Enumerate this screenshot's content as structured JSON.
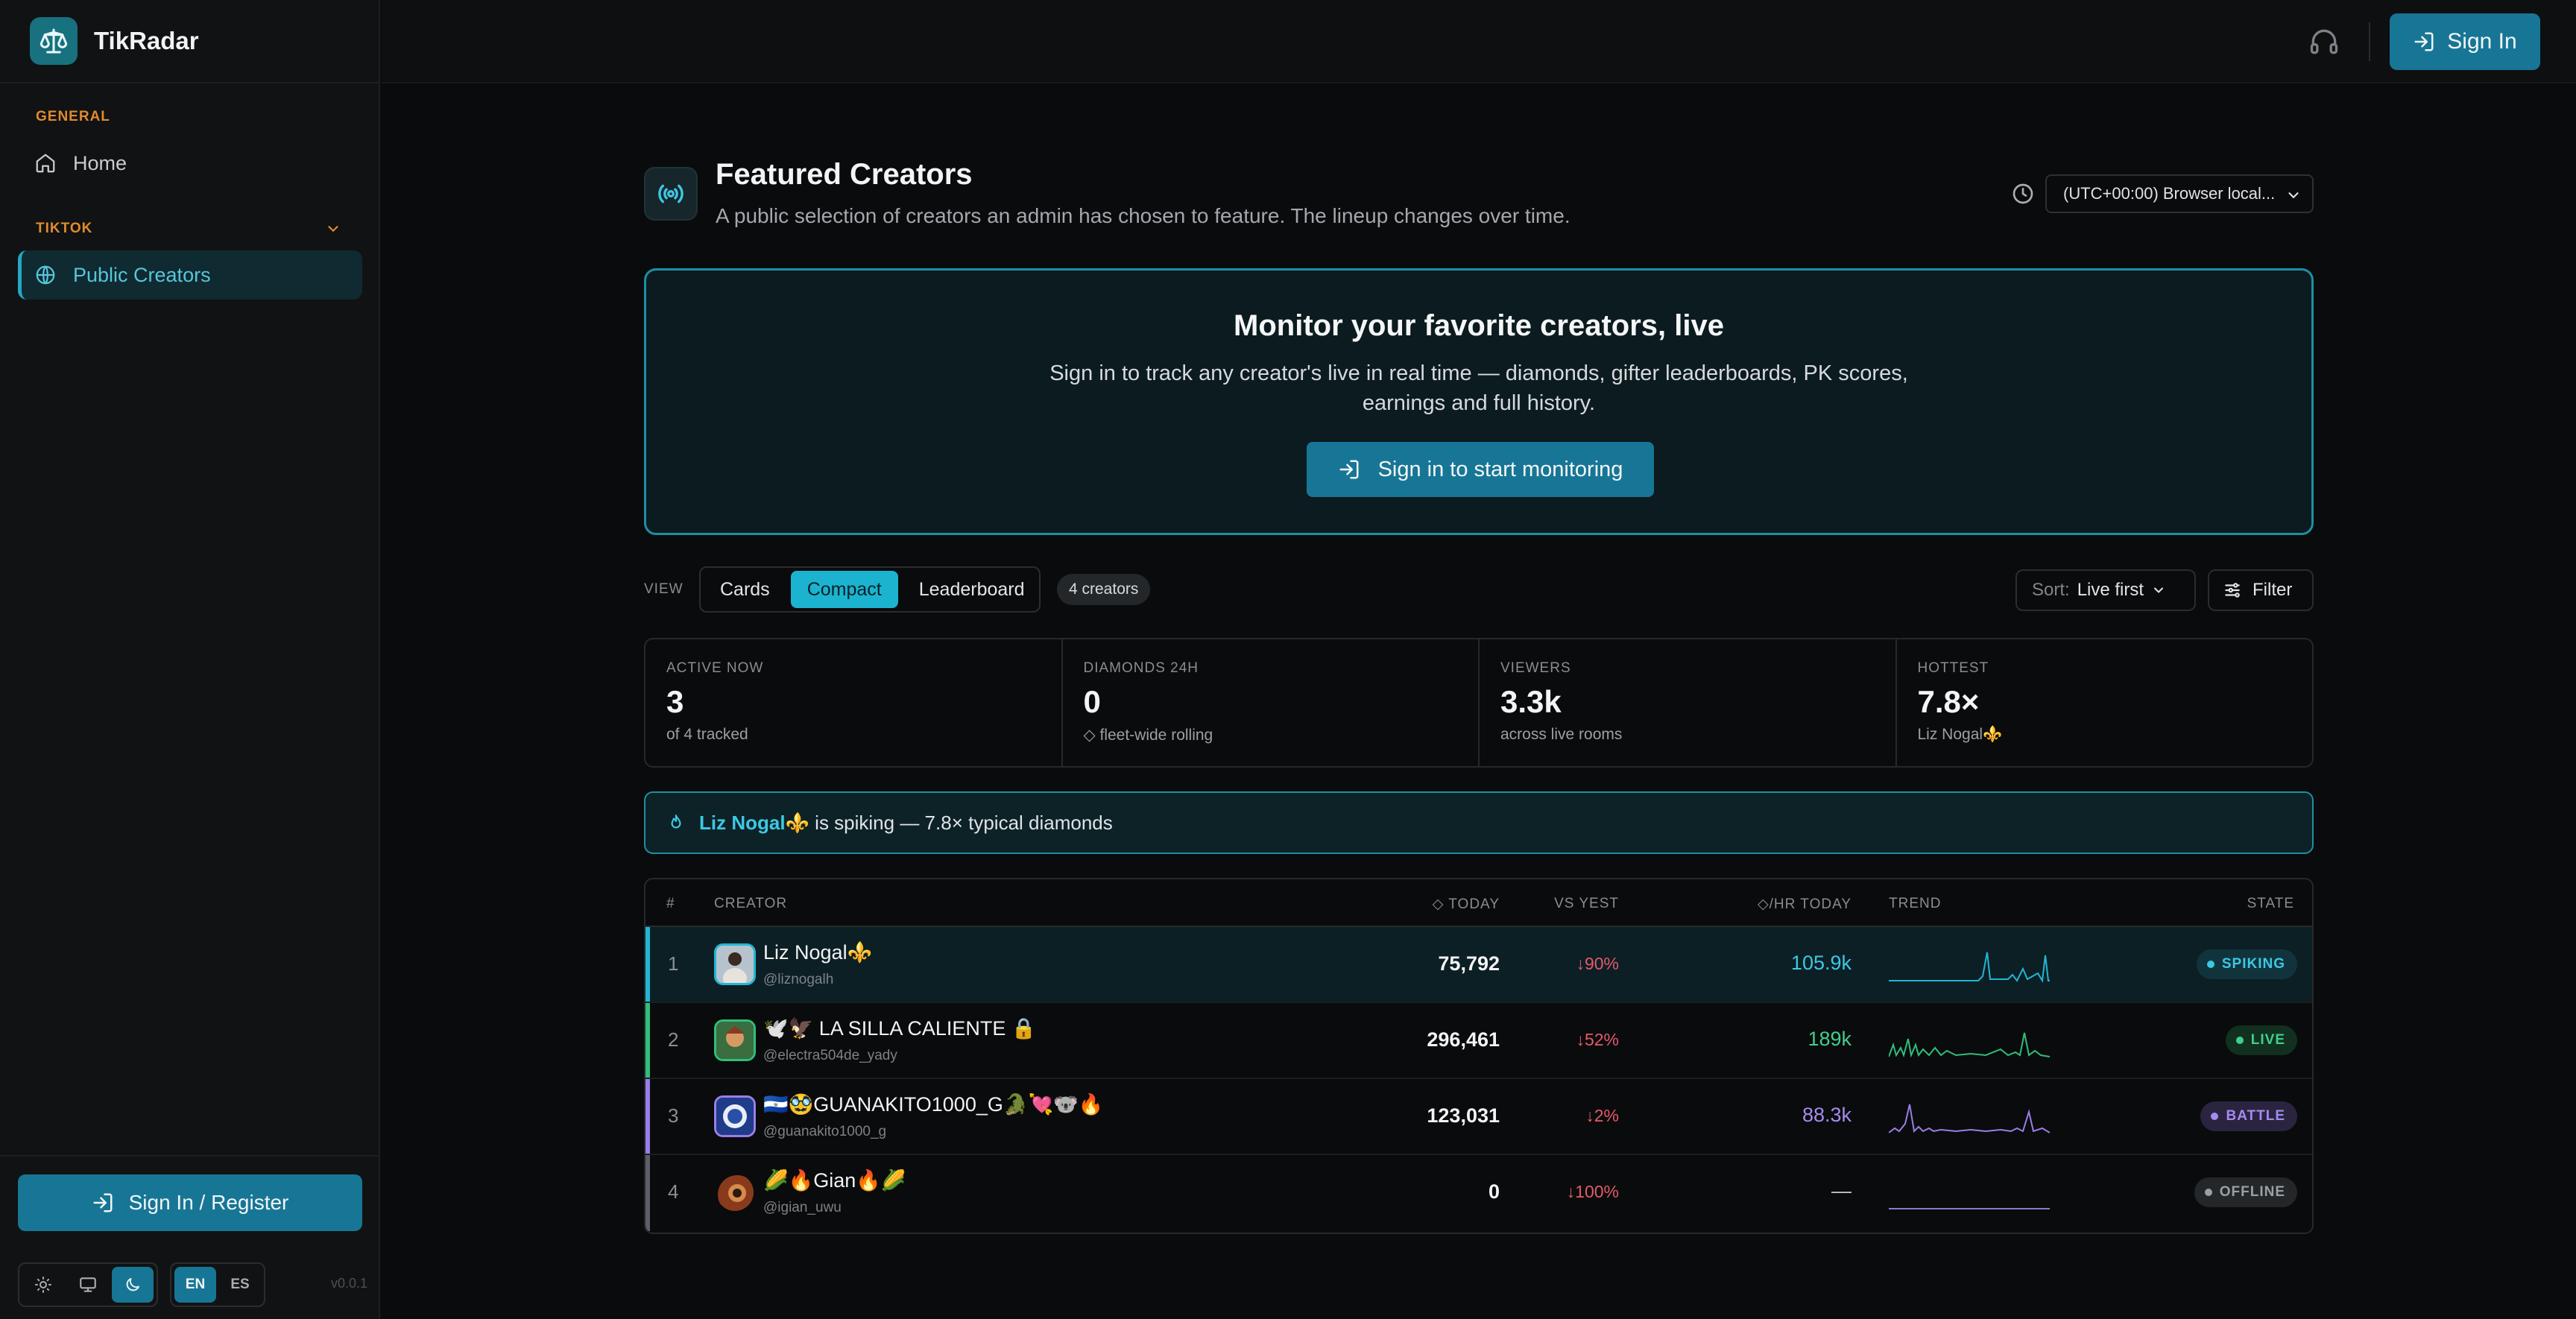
{
  "app": {
    "name": "TikRadar"
  },
  "sidebar": {
    "section_general": "GENERAL",
    "home_label": "Home",
    "section_tiktok": "TIKTOK",
    "public_creators_label": "Public Creators",
    "signin_register_label": "Sign In / Register",
    "lang_en": "EN",
    "lang_es": "ES",
    "version": "v0.0.1"
  },
  "header": {
    "signin_label": "Sign In"
  },
  "page": {
    "title": "Featured Creators",
    "subtitle": "A public selection of creators an admin has chosen to feature. The lineup changes over time.",
    "timezone": "(UTC+00:00) Browser local..."
  },
  "hero": {
    "title": "Monitor your favorite creators, live",
    "text": "Sign in to track any creator's live in real time — diamonds, gifter leaderboards, PK scores, earnings and full history.",
    "button_label": "Sign in to start monitoring"
  },
  "view": {
    "label": "VIEW",
    "tabs": [
      "Cards",
      "Compact",
      "Leaderboard"
    ],
    "active_tab": "Compact",
    "count": "4 creators",
    "sort_prefix": "Sort:",
    "sort_value": "Live first",
    "filter_label": "Filter"
  },
  "stats": [
    {
      "label": "ACTIVE NOW",
      "value": "3",
      "sub": "of 4 tracked"
    },
    {
      "label": "DIAMONDS 24H",
      "value": "0",
      "sub": "◇ fleet-wide rolling"
    },
    {
      "label": "VIEWERS",
      "value": "3.3k",
      "sub": "across live rooms"
    },
    {
      "label": "HOTTEST",
      "value": "7.8×",
      "sub": "Liz Nogal⚜️"
    }
  ],
  "alert": {
    "name": "Liz Nogal⚜️",
    "text": "is spiking — 7.8× typical diamonds"
  },
  "table": {
    "headers": {
      "rank": "#",
      "creator": "CREATOR",
      "today": "◇ TODAY",
      "vs_yest": "VS YEST",
      "hr_today": "◇/HR TODAY",
      "trend": "TREND",
      "state": "STATE"
    },
    "rows": [
      {
        "rank": "1",
        "name": "Liz Nogal⚜️",
        "handle": "@liznogalh",
        "today": "75,792",
        "vs_yest": "↓90%",
        "hr": "105.9k",
        "state": "SPIKING",
        "accent": "#22b6d4"
      },
      {
        "rank": "2",
        "name": "🕊️🦅 LA SILLA CALIENTE 🔒",
        "handle": "@electra504de_yady",
        "today": "296,461",
        "vs_yest": "↓52%",
        "hr": "189k",
        "state": "LIVE",
        "accent": "#2fbf7c"
      },
      {
        "rank": "3",
        "name": "🇸🇻🥸GUANAKITO1000_G🐊💘🐨🔥",
        "handle": "@guanakito1000_g",
        "today": "123,031",
        "vs_yest": "↓2%",
        "hr": "88.3k",
        "state": "BATTLE",
        "accent": "#9a7ee8"
      },
      {
        "rank": "4",
        "name": "🌽🔥Gian🔥🌽",
        "handle": "@igian_uwu",
        "today": "0",
        "vs_yest": "↓100%",
        "hr": "—",
        "state": "OFFLINE",
        "accent": "#5b6068"
      }
    ]
  },
  "colors": {
    "accent": "#177695",
    "cyan": "#22b6d4",
    "live": "#2fbf7c",
    "battle": "#9a7ee8",
    "down": "#e45a6b",
    "section": "#e08b2c"
  }
}
